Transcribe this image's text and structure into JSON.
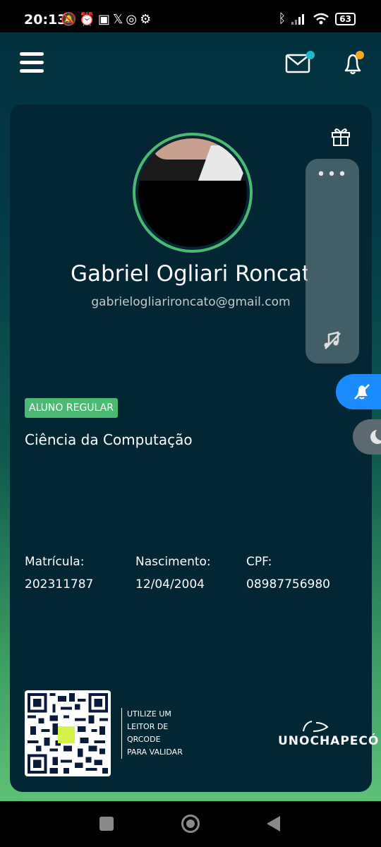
{
  "status_bar": {
    "time": "20:13",
    "left_icons": [
      "bell-off-icon",
      "alarm-icon",
      "nfc-icon",
      "x-icon",
      "instagram-icon",
      "steam-icon"
    ],
    "battery": "63"
  },
  "profile": {
    "name": "Gabriel Ogliari Roncato",
    "email": "gabrielogliarironcato@gmail.com",
    "status_badge": "ALUNO REGULAR",
    "course": "Ciência da Computação"
  },
  "details": {
    "matricula_label": "Matrícula:",
    "matricula_value": "202311787",
    "nascimento_label": "Nascimento:",
    "nascimento_value": "12/04/2004",
    "cpf_label": "CPF:",
    "cpf_value": "08987756980"
  },
  "qr": {
    "line1": "UTILIZE UM",
    "line2": "LEITOR DE",
    "line3": "QRCODE",
    "line4": "PARA VALIDAR"
  },
  "brand": {
    "logo_text": "UNOCHAPECÓ"
  },
  "colors": {
    "accent_green": "#4cb972",
    "mail_dot": "#1fb6d4",
    "bell_dot": "#f5a623",
    "mute_button": "#1a8cff",
    "card_bg": "#022633"
  }
}
